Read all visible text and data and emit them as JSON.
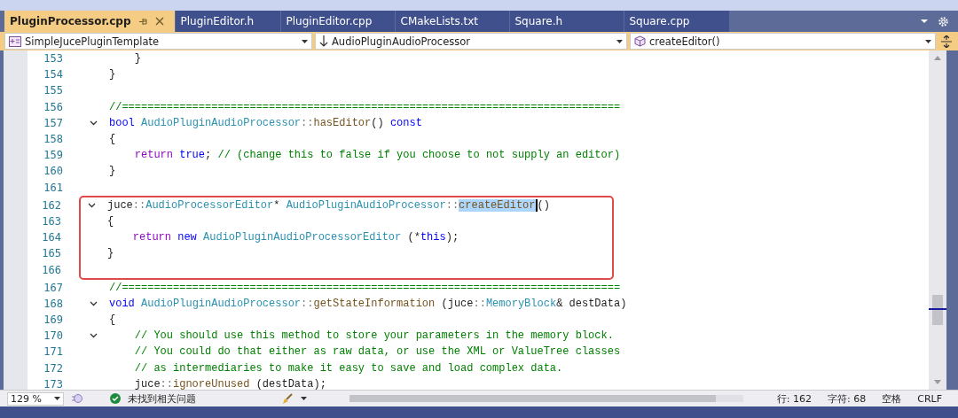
{
  "tabs": [
    {
      "label": "PluginProcessor.cpp",
      "selected": true,
      "pinned": true
    },
    {
      "label": "PluginEditor.h",
      "selected": false,
      "pinned": false
    },
    {
      "label": "PluginEditor.cpp",
      "selected": false,
      "pinned": false
    },
    {
      "label": "CMakeLists.txt",
      "selected": false,
      "pinned": false
    },
    {
      "label": "Square.h",
      "selected": false,
      "pinned": false
    },
    {
      "label": "Square.cpp",
      "selected": false,
      "pinned": false
    }
  ],
  "navigation_bar": {
    "project": "SimpleJucePluginTemplate",
    "class": "AudioPluginAudioProcessor",
    "member": "createEditor()"
  },
  "editor": {
    "lines": [
      {
        "number": "153",
        "fold": false,
        "boxed": false,
        "indented": true,
        "tokens": [
          {
            "kind": "plain",
            "text": "}"
          }
        ]
      },
      {
        "number": "154",
        "fold": false,
        "boxed": false,
        "indented": false,
        "tokens": [
          {
            "kind": "plain",
            "text": "}"
          }
        ]
      },
      {
        "number": "155",
        "fold": false,
        "boxed": false
      },
      {
        "number": "156",
        "fold": false,
        "boxed": false,
        "indented": false,
        "tokens": [
          {
            "kind": "comment",
            "text": "//=============================================================================="
          }
        ]
      },
      {
        "number": "157",
        "fold": true,
        "boxed": false,
        "indented": false,
        "tokens": [
          {
            "kind": "keyword",
            "text": "bool "
          },
          {
            "kind": "type",
            "text": "AudioPluginAudioProcessor"
          },
          {
            "kind": "punct",
            "text": "::"
          },
          {
            "kind": "function",
            "text": "hasEditor"
          },
          {
            "kind": "plain",
            "text": "() "
          },
          {
            "kind": "keyword",
            "text": "const"
          }
        ]
      },
      {
        "number": "158",
        "fold": false,
        "boxed": false,
        "indented": false,
        "tokens": [
          {
            "kind": "plain",
            "text": "{"
          }
        ]
      },
      {
        "number": "159",
        "fold": false,
        "boxed": false,
        "indented": true,
        "tokens": [
          {
            "kind": "control",
            "text": "return "
          },
          {
            "kind": "keyword",
            "text": "true"
          },
          {
            "kind": "plain",
            "text": "; "
          },
          {
            "kind": "comment",
            "text": "// (change this to false if you choose to not supply an editor)"
          }
        ]
      },
      {
        "number": "160",
        "fold": false,
        "boxed": false,
        "indented": false,
        "tokens": [
          {
            "kind": "plain",
            "text": "}"
          }
        ]
      },
      {
        "number": "161",
        "fold": false,
        "boxed": false
      },
      {
        "number": "162",
        "fold": true,
        "boxed": true,
        "indented": false,
        "tokens": [
          {
            "kind": "plain",
            "text": "juce"
          },
          {
            "kind": "punct",
            "text": "::"
          },
          {
            "kind": "type",
            "text": "AudioProcessorEditor"
          },
          {
            "kind": "plain",
            "text": "* "
          },
          {
            "kind": "type",
            "text": "AudioPluginAudioProcessor"
          },
          {
            "kind": "punct",
            "text": "::"
          },
          {
            "kind": "selection",
            "text": "createEditor"
          },
          {
            "kind": "plain",
            "text": "()"
          }
        ]
      },
      {
        "number": "163",
        "fold": false,
        "boxed": true,
        "indented": false,
        "tokens": [
          {
            "kind": "plain",
            "text": "{"
          }
        ]
      },
      {
        "number": "164",
        "fold": false,
        "boxed": true,
        "indented": true,
        "tokens": [
          {
            "kind": "control",
            "text": "return "
          },
          {
            "kind": "keyword",
            "text": "new "
          },
          {
            "kind": "type",
            "text": "AudioPluginAudioProcessorEditor"
          },
          {
            "kind": "plain",
            "text": " (*"
          },
          {
            "kind": "keyword",
            "text": "this"
          },
          {
            "kind": "plain",
            "text": ");"
          }
        ]
      },
      {
        "number": "165",
        "fold": false,
        "boxed": true,
        "indented": false,
        "tokens": [
          {
            "kind": "plain",
            "text": "}"
          }
        ]
      },
      {
        "number": "166",
        "fold": false,
        "boxed": true
      },
      {
        "number": "167",
        "fold": false,
        "boxed": false,
        "indented": false,
        "tokens": [
          {
            "kind": "comment",
            "text": "//=============================================================================="
          }
        ]
      },
      {
        "number": "168",
        "fold": true,
        "boxed": false,
        "indented": false,
        "tokens": [
          {
            "kind": "keyword",
            "text": "void "
          },
          {
            "kind": "type",
            "text": "AudioPluginAudioProcessor"
          },
          {
            "kind": "punct",
            "text": "::"
          },
          {
            "kind": "function",
            "text": "getStateInformation"
          },
          {
            "kind": "plain",
            "text": " (juce"
          },
          {
            "kind": "punct",
            "text": "::"
          },
          {
            "kind": "type",
            "text": "MemoryBlock"
          },
          {
            "kind": "plain",
            "text": "& destData)"
          }
        ]
      },
      {
        "number": "169",
        "fold": false,
        "boxed": false,
        "indented": false,
        "tokens": [
          {
            "kind": "plain",
            "text": "{"
          }
        ]
      },
      {
        "number": "170",
        "fold": true,
        "boxed": false,
        "indented": true,
        "tokens": [
          {
            "kind": "comment",
            "text": "// You should use this method to store your parameters in the memory block."
          }
        ]
      },
      {
        "number": "171",
        "fold": false,
        "boxed": false,
        "indented": true,
        "tokens": [
          {
            "kind": "comment",
            "text": "// You could do that either as raw data, or use the XML or ValueTree classes"
          }
        ]
      },
      {
        "number": "172",
        "fold": false,
        "boxed": false,
        "indented": true,
        "tokens": [
          {
            "kind": "comment",
            "text": "// as intermediaries to make it easy to save and load complex data."
          }
        ]
      },
      {
        "number": "173",
        "fold": false,
        "boxed": false,
        "indented": true,
        "tokens": [
          {
            "kind": "plain",
            "text": "juce"
          },
          {
            "kind": "punct",
            "text": "::"
          },
          {
            "kind": "function",
            "text": "ignoreUnused"
          },
          {
            "kind": "plain",
            "text": " (destData);"
          }
        ]
      }
    ]
  },
  "status_bar": {
    "zoom": "129 %",
    "issues": "未找到相关问题",
    "line": "行: 162",
    "column": "字符: 68",
    "whitespace": "空格",
    "line_ending": "CRLF"
  }
}
